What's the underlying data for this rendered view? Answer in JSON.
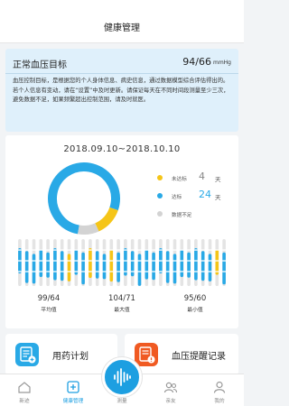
{
  "header": {
    "title": "健康管理"
  },
  "target": {
    "title": "正常血压目标",
    "value": "94/66",
    "unit": "mmHg",
    "description": "血压控制目标，是根据您的个人身体信息、病史信息，通过数据模型综合评估得出的。若个人信息有变动，请在“设置”中及时更新。请保证每天在不同时间段测量至少三次，避免数据不足，如果频繁超出控制范围，请及时就医。"
  },
  "stats": {
    "date_range": "2018.09.10~2018.10.10",
    "legend": [
      {
        "label": "未达标",
        "value": "4",
        "unit": "天",
        "color": "#f5c518"
      },
      {
        "label": "达标",
        "value": "24",
        "unit": "天",
        "color": "#29a9e6"
      },
      {
        "label": "数据不足",
        "value": "",
        "unit": "",
        "color": "#d3d3d3"
      }
    ],
    "donut": {
      "not_met": 4,
      "met": 24,
      "insufficient": 3
    },
    "daily": [
      "blue",
      "blue",
      "blue",
      "blue",
      "blue",
      "blue",
      "blue",
      "yellow",
      "blue",
      "blue",
      "yellow",
      "blue",
      "blue",
      "yellow",
      "blue",
      "blue",
      "blue",
      "blue",
      "blue",
      "blue",
      "blue",
      "blue",
      "blue",
      "blue",
      "blue",
      "blue",
      "blue",
      "blue",
      "yellow",
      "blue"
    ],
    "summary": [
      {
        "value": "99/64",
        "label": "平均值"
      },
      {
        "value": "104/71",
        "label": "最大值"
      },
      {
        "value": "95/60",
        "label": "最小值"
      }
    ]
  },
  "actions": {
    "medication_plan": "用药计划",
    "bp_reminder": "血压提醒记录"
  },
  "tabs": [
    {
      "label": "新迹"
    },
    {
      "label": "健康管理"
    },
    {
      "label": "测量"
    },
    {
      "label": "亲友"
    },
    {
      "label": "我的"
    }
  ],
  "colors": {
    "accent": "#1d9fe1",
    "warning": "#f5c518",
    "danger": "#f05a22"
  }
}
